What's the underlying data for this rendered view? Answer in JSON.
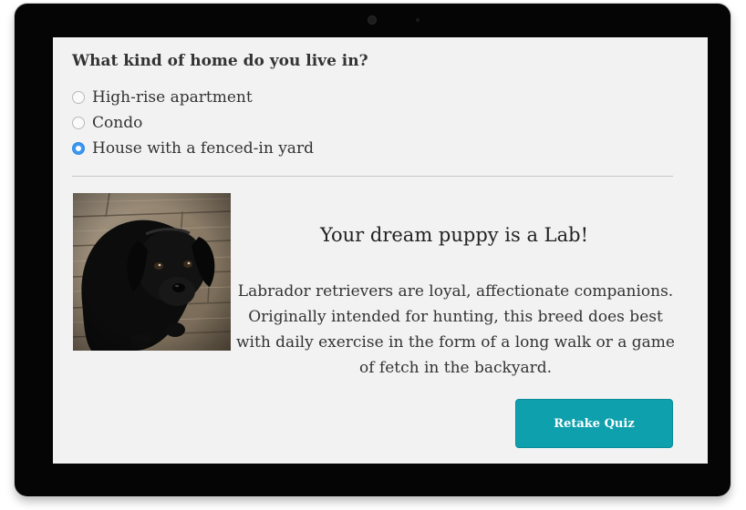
{
  "quiz": {
    "question": "What kind of home do you live in?",
    "options": [
      {
        "label": "High-rise apartment",
        "selected": false
      },
      {
        "label": "Condo",
        "selected": false
      },
      {
        "label": "House with a fenced-in yard",
        "selected": true
      }
    ]
  },
  "result": {
    "title": "Your dream puppy is a Lab!",
    "description": "Labrador retrievers are loyal, affectionate companions. Originally intended for hunting, this breed does best with daily exercise in the form of a long walk or a game of fetch in the backyard.",
    "image_icon": "black-labrador-puppy-photo"
  },
  "actions": {
    "retake_label": "Retake Quiz"
  },
  "colors": {
    "accent": "#0fa0ad",
    "radio_selected": "#3c97f0",
    "screen_bg": "#f2f2f2"
  }
}
